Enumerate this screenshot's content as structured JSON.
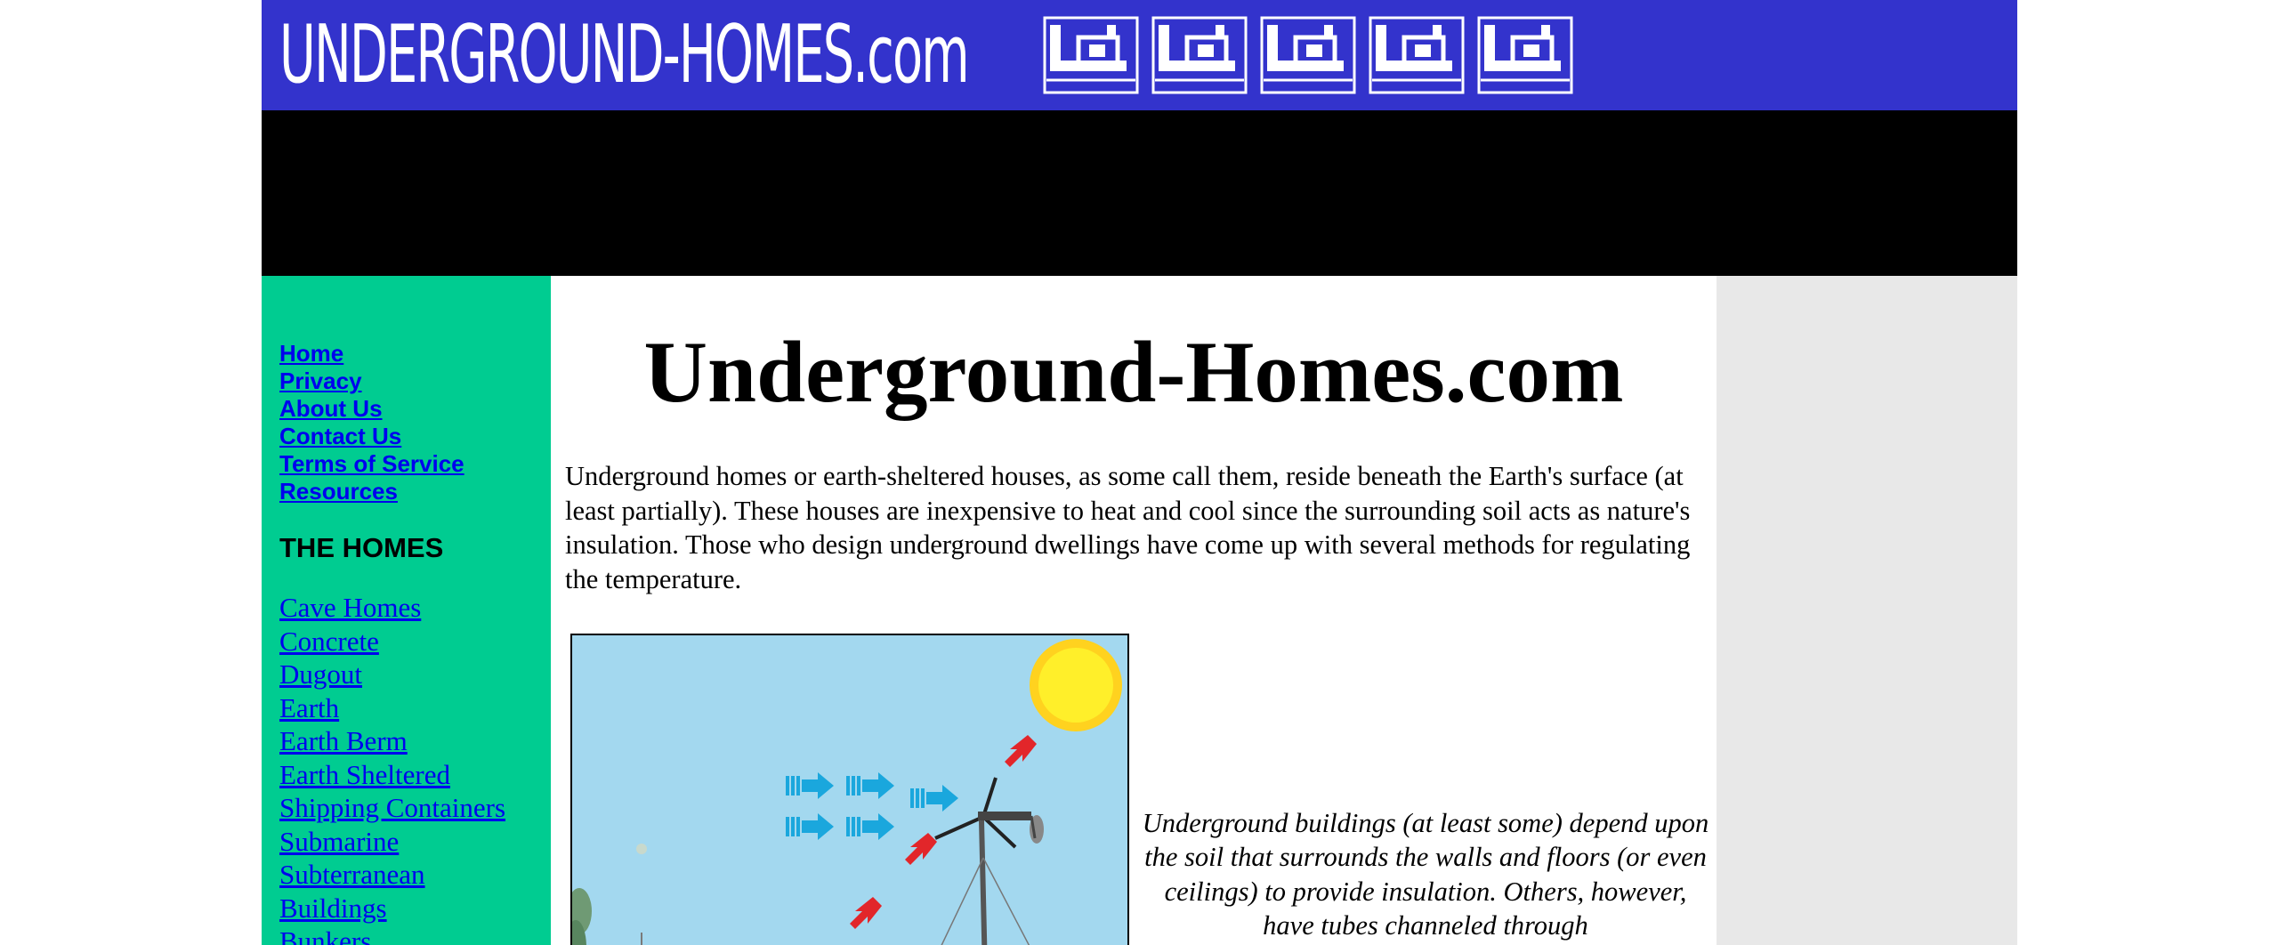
{
  "banner": {
    "logo_text": "UNDERGROUND-HOMES.com",
    "background_color": "#3333cc",
    "icon_count": 5
  },
  "sidebar": {
    "background_color": "#00cc91",
    "quick_links": [
      "Home",
      "Privacy",
      "About Us",
      "Contact Us",
      "Terms of Service",
      "Resources"
    ],
    "homes_heading": "THE HOMES",
    "home_links": [
      "Cave Homes",
      "Concrete",
      "Dugout",
      "Earth",
      "Earth Berm",
      "Earth Sheltered",
      "Shipping Containers",
      "Submarine",
      "Subterranean",
      "Buildings",
      "Bunkers"
    ]
  },
  "main": {
    "title": "Underground-Homes.com",
    "intro": "Underground homes or earth-sheltered houses, as some call them, reside beneath the Earth's surface (at least partially). These houses are inexpensive to heat and cool since the surrounding soil acts as nature's insulation. Those who design underground dwellings have come up with several methods for regulating the temperature.",
    "caption": "Underground buildings (at least some) depend upon the soil that surrounds the walls and floors (or even ceilings) to provide insulation. Others, however, have tubes channeled through"
  }
}
